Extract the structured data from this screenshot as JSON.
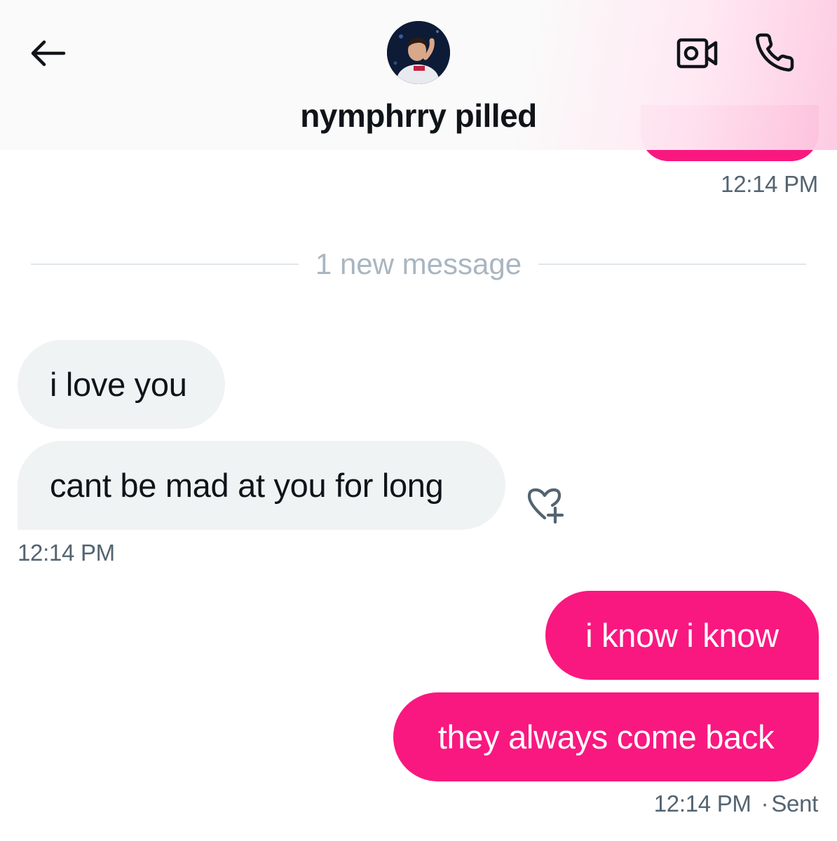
{
  "header": {
    "contact_name": "nymphrry pilled",
    "back_icon": "arrow-left-icon",
    "video_icon": "video-camera-icon",
    "call_icon": "phone-icon"
  },
  "divider": {
    "label": "1 new message"
  },
  "messages": [
    {
      "direction": "outgoing",
      "text": "",
      "time": "12:14 PM"
    },
    {
      "direction": "incoming",
      "text": "i love you"
    },
    {
      "direction": "incoming",
      "text": "cant be mad at you for long",
      "time": "12:14 PM"
    },
    {
      "direction": "outgoing",
      "text": "i know i know"
    },
    {
      "direction": "outgoing",
      "text": "they always come back",
      "time": "12:14 PM",
      "status": "Sent"
    }
  ],
  "status_separator": "·",
  "colors": {
    "accent": "#f91880",
    "incoming_bubble": "#eff3f4",
    "text_primary": "#0f1419",
    "text_secondary": "#536471",
    "divider_text": "#a9b6c1"
  }
}
